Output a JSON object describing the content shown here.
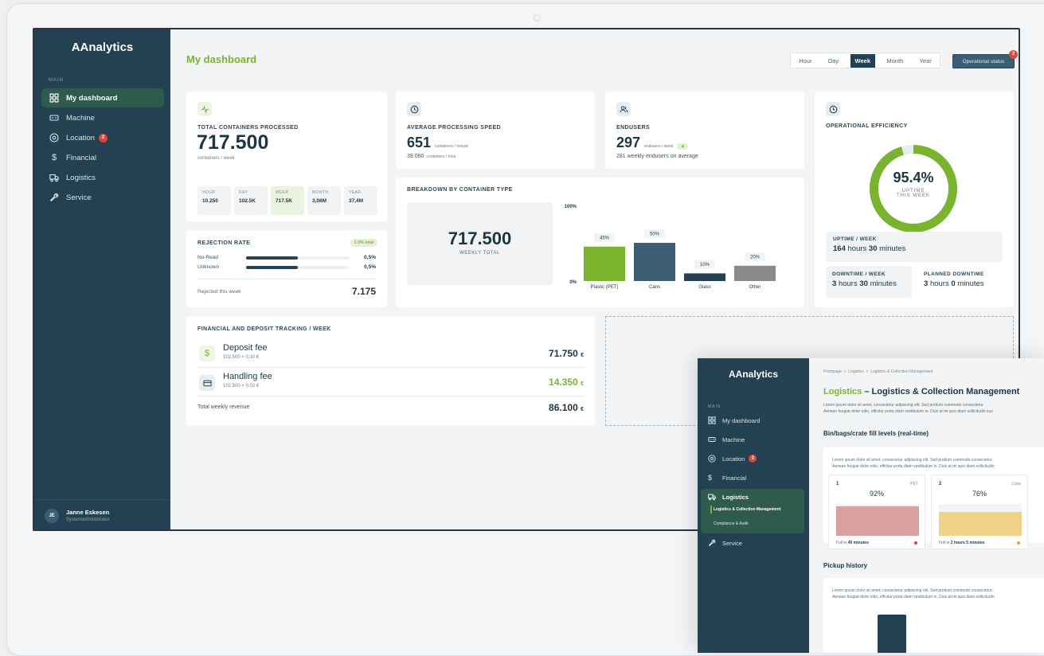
{
  "app": {
    "logo_a": "AAnaly",
    "logo_t": "t",
    "logo_b": "ics",
    "section_label": "MAIN"
  },
  "sidebar": {
    "items": [
      {
        "label": "My dashboard",
        "icon": "grid-icon"
      },
      {
        "label": "Machine",
        "icon": "machine-icon"
      },
      {
        "label": "Location",
        "icon": "location-icon",
        "badge": "2"
      },
      {
        "label": "Financial",
        "icon": "dollar-icon"
      },
      {
        "label": "Logistics",
        "icon": "truck-icon"
      },
      {
        "label": "Service",
        "icon": "wrench-icon"
      }
    ]
  },
  "user": {
    "initials": "JE",
    "name": "Janne Eskesen",
    "role": "Systemadministrator"
  },
  "header": {
    "title": "My dashboard",
    "periods": [
      "Hour",
      "Day",
      "Week",
      "Month",
      "Year"
    ],
    "selected_period": "Week",
    "status_button": "Operational status",
    "status_badge": "2"
  },
  "total": {
    "label": "TOTAL CONTAINERS PROCESSED",
    "value": "717.500",
    "unit": "containers / week",
    "tiles": [
      {
        "k": "HOUR",
        "v": "10.250"
      },
      {
        "k": "DAY",
        "v": "102.5K"
      },
      {
        "k": "WEEK",
        "v": "717.5K"
      },
      {
        "k": "MONTH",
        "v": "3,08M"
      },
      {
        "k": "YEAR",
        "v": "37,4M"
      }
    ]
  },
  "speed": {
    "label": "AVERAGE PROCESSING SPEED",
    "value": "651",
    "unit": "containers / minute",
    "secondary_value": "39.060",
    "secondary_unit": "containers / hour"
  },
  "endusers": {
    "label": "ENDUSERS",
    "value": "297",
    "unit": "endusers / week",
    "note": "281 weekly endusers on average"
  },
  "efficiency": {
    "label": "OPERATIONAL EFFICIENCY",
    "percent": 95.4,
    "percent_text": "95.4%",
    "caption1": "UPTIME",
    "caption2": "THIS WEEK",
    "uptime_label": "UPTIME / WEEK",
    "uptime_h": "164",
    "uptime_hw": "hours",
    "uptime_m": "30",
    "uptime_mw": "minutes",
    "downtime_label": "DOWNTIME / WEEK",
    "downtime_h": "3",
    "downtime_hw": "hours",
    "downtime_m": "30",
    "downtime_mw": "minutes",
    "planned_label": "PLANNED DOWNTIME",
    "planned_h": "3",
    "planned_hw": "hours",
    "planned_m": "0",
    "planned_mw": "minutes"
  },
  "rejection": {
    "label": "REJECTION RATE",
    "badge": "1.0% total",
    "rows": [
      {
        "name": "No-Read",
        "value": "0,5%",
        "fill": 0.5
      },
      {
        "name": "Unknown",
        "value": "0,5%",
        "fill": 0.5
      }
    ],
    "footer_label": "Rejected this week",
    "footer_value": "7.175"
  },
  "breakdown": {
    "label": "BREAKDOWN BY CONTAINER TYPE",
    "total": "717.500",
    "total_label": "WEEKLY TOTAL"
  },
  "chart_data": {
    "type": "bar",
    "categories": [
      "Plastic (PET)",
      "Cans",
      "Glass",
      "Other"
    ],
    "values": [
      45,
      50,
      10,
      20
    ],
    "value_labels": [
      "45%",
      "50%",
      "10%",
      "20%"
    ],
    "ylim": [
      0,
      100
    ],
    "y_top_label": "100%",
    "y_bottom_label": "0%",
    "colors": [
      "#7ab32e",
      "#3c5e74",
      "#234150",
      "#8a8a8a"
    ]
  },
  "financial": {
    "label": "FINANCIAL AND DEPOSIT TRACKING / WEEK",
    "rows": [
      {
        "name": "Deposit fee",
        "detail": "102.500 × 0,10 €",
        "value": "71.750",
        "currency": "€"
      },
      {
        "name": "Handling fee",
        "detail": "102.500 × 0,02 €",
        "value": "14.350",
        "currency": "€"
      }
    ],
    "total_label": "Total weekly revenue",
    "total_value": "86.100",
    "total_currency": "€"
  },
  "overlay": {
    "logo_a": "AAnaly",
    "logo_t": "t",
    "logo_b": "ics",
    "section_label": "MAIN",
    "nav": [
      "My dashboard",
      "Machine",
      "Location",
      "Financial",
      "Logistics",
      "Service"
    ],
    "location_badge": "2",
    "subnav": [
      "Logistics & Collection Management",
      "Compliance & Audit"
    ],
    "breadcrumb": [
      "Frontpage",
      ">",
      "Logistics",
      ">",
      "Logistics & Collection Management"
    ],
    "title_green": "Logistics",
    "title_rest": " – Logistics & Collection Management",
    "lorem1": "Lorem ipsum dolor sit amet, consectetur adipiscing elit. Sed pretium commodo consectetur.",
    "lorem2": "Aenean feugiat dolor odio, efficitur porta diam vestibulum in. Duis at mi quis diam sollicitudin sus",
    "section1": "Bin/bags/crate fill levels (real-time)",
    "card_lorem1": "Lorem ipsum dolor sit amet, consectetur adipiscing elit. Sed pretium commodo consectetur.",
    "card_lorem2": "Aenean feugiat dolor odio, efficitur porta diam vestibulum in. Duis at mi quis diam sollicitudin",
    "bins": [
      {
        "num": "1",
        "type": "PET",
        "percent": "92%",
        "fill": 0.92,
        "color": "#d9a0a0",
        "footer_a": "Full in ",
        "footer_b": "45 minutes",
        "dot": "#d9453b"
      },
      {
        "num": "2",
        "type": "Cans",
        "percent": "76%",
        "fill": 0.76,
        "color": "#f1d089",
        "footer_a": "Full in ",
        "footer_b": "2 hours 5 minutes",
        "dot": "#e9a43a"
      }
    ],
    "section2": "Pickup history",
    "card2_lorem1": "Lorem ipsum dolor sit amet, consectetur adipiscing elit. Sed pretium commodo consectetur.",
    "card2_lorem2": "Aenean feugiat dolor odio, efficitur porta diam vestibulum in. Duis at mi quis diam sollicitudin"
  }
}
